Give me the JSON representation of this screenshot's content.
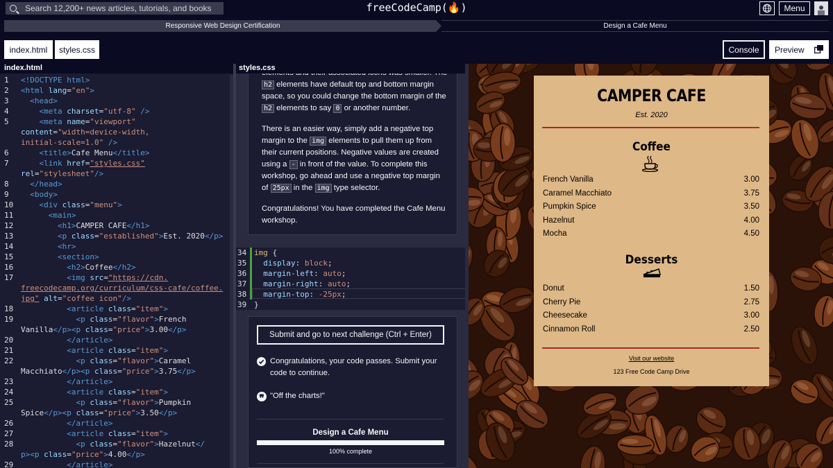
{
  "nav": {
    "search_placeholder": "Search 12,200+ news articles, tutorials, and books",
    "logo": "freeCodeCamp(🔥)",
    "menu_label": "Menu"
  },
  "breadcrumb": {
    "certification": "Responsive Web Design Certification",
    "workshop": "Design a Cafe Menu"
  },
  "tabs": {
    "index": "index.html",
    "styles": "styles.css"
  },
  "buttons": {
    "console": "Console",
    "preview": "Preview"
  },
  "left_editor": {
    "title": "index.html",
    "lines": [
      {
        "n": "1",
        "h": "<span class='t'>&lt;!DOCTYPE html&gt;</span>"
      },
      {
        "n": "2",
        "h": "<span class='t'>&lt;html</span> <span class='a'>lang</span>=<span class='s'>\"en\"</span><span class='t'>&gt;</span>"
      },
      {
        "n": "3",
        "h": "  <span class='t'>&lt;head&gt;</span>"
      },
      {
        "n": "4",
        "h": "    <span class='t'>&lt;meta</span> <span class='a'>charset</span>=<span class='s'>\"utf-8\"</span> <span class='t'>/&gt;</span>"
      },
      {
        "n": "5",
        "h": "    <span class='t'>&lt;meta</span> <span class='a'>name</span>=<span class='s'>\"viewport\"</span>"
      },
      {
        "n": "",
        "h": "<span class='a'>content</span>=<span class='s'>\"width=device-width,</span>"
      },
      {
        "n": "",
        "h": "<span class='s'>initial-scale=1.0\"</span> <span class='t'>/&gt;</span>"
      },
      {
        "n": "6",
        "h": "    <span class='t'>&lt;title&gt;</span>Cafe Menu<span class='t'>&lt;/title&gt;</span>"
      },
      {
        "n": "7",
        "h": "    <span class='t'>&lt;link</span> <span class='a'>href</span>=<span class='s u'>\"styles.css\"</span>"
      },
      {
        "n": "",
        "h": "<span class='a'>rel</span>=<span class='s'>\"stylesheet\"</span><span class='t'>/&gt;</span>"
      },
      {
        "n": "8",
        "h": "  <span class='t'>&lt;/head&gt;</span>"
      },
      {
        "n": "9",
        "h": "  <span class='t'>&lt;body&gt;</span>"
      },
      {
        "n": "10",
        "h": "    <span class='t'>&lt;div</span> <span class='a'>class</span>=<span class='s'>\"menu\"</span><span class='t'>&gt;</span>"
      },
      {
        "n": "11",
        "h": "      <span class='t'>&lt;main&gt;</span>"
      },
      {
        "n": "12",
        "h": "        <span class='t'>&lt;h1&gt;</span>CAMPER CAFE<span class='t'>&lt;/h1&gt;</span>"
      },
      {
        "n": "13",
        "h": "        <span class='t'>&lt;p</span> <span class='a'>class</span>=<span class='s'>\"established\"</span><span class='t'>&gt;</span>Est. 2020<span class='t'>&lt;/p&gt;</span>"
      },
      {
        "n": "14",
        "h": "        <span class='t'>&lt;hr&gt;</span>"
      },
      {
        "n": "15",
        "h": "        <span class='t'>&lt;section&gt;</span>"
      },
      {
        "n": "16",
        "h": "          <span class='t'>&lt;h2&gt;</span>Coffee<span class='t'>&lt;/h2&gt;</span>"
      },
      {
        "n": "17",
        "h": "          <span class='t'>&lt;img</span> <span class='a'>src</span>=<span class='s u'>\"https://cdn.</span>"
      },
      {
        "n": "",
        "h": "<span class='s u'>freecodecamp.org/curriculum/css-cafe/coffee.</span>"
      },
      {
        "n": "",
        "h": "<span class='s u'>jpg\"</span> <span class='a'>alt</span>=<span class='s'>\"coffee icon\"</span><span class='t'>/&gt;</span>"
      },
      {
        "n": "18",
        "h": "          <span class='t'>&lt;article</span> <span class='a'>class</span>=<span class='s'>\"item\"</span><span class='t'>&gt;</span>"
      },
      {
        "n": "19",
        "h": "            <span class='t'>&lt;p</span> <span class='a'>class</span>=<span class='s'>\"flavor\"</span><span class='t'>&gt;</span>French"
      },
      {
        "n": "",
        "h": "Vanilla<span class='t'>&lt;/p&gt;&lt;p</span> <span class='a'>class</span>=<span class='s'>\"price\"</span><span class='t'>&gt;</span>3.00<span class='t'>&lt;/p&gt;</span>"
      },
      {
        "n": "20",
        "h": "          <span class='t'>&lt;/article&gt;</span>"
      },
      {
        "n": "21",
        "h": "          <span class='t'>&lt;article</span> <span class='a'>class</span>=<span class='s'>\"item\"</span><span class='t'>&gt;</span>"
      },
      {
        "n": "22",
        "h": "            <span class='t'>&lt;p</span> <span class='a'>class</span>=<span class='s'>\"flavor\"</span><span class='t'>&gt;</span>Caramel"
      },
      {
        "n": "",
        "h": "Macchiato<span class='t'>&lt;/p&gt;&lt;p</span> <span class='a'>class</span>=<span class='s'>\"price\"</span><span class='t'>&gt;</span>3.75<span class='t'>&lt;/p&gt;</span>"
      },
      {
        "n": "23",
        "h": "          <span class='t'>&lt;/article&gt;</span>"
      },
      {
        "n": "24",
        "h": "          <span class='t'>&lt;article</span> <span class='a'>class</span>=<span class='s'>\"item\"</span><span class='t'>&gt;</span>"
      },
      {
        "n": "25",
        "h": "            <span class='t'>&lt;p</span> <span class='a'>class</span>=<span class='s'>\"flavor\"</span><span class='t'>&gt;</span>Pumpkin"
      },
      {
        "n": "",
        "h": "Spice<span class='t'>&lt;/p&gt;&lt;p</span> <span class='a'>class</span>=<span class='s'>\"price\"</span><span class='t'>&gt;</span>3.50<span class='t'>&lt;/p&gt;</span>"
      },
      {
        "n": "26",
        "h": "          <span class='t'>&lt;/article&gt;</span>"
      },
      {
        "n": "27",
        "h": "          <span class='t'>&lt;article</span> <span class='a'>class</span>=<span class='s'>\"item\"</span><span class='t'>&gt;</span>"
      },
      {
        "n": "28",
        "h": "            <span class='t'>&lt;p</span> <span class='a'>class</span>=<span class='s'>\"flavor\"</span><span class='t'>&gt;</span>Hazelnut<span class='t'>&lt;/</span>"
      },
      {
        "n": "",
        "h": "<span class='t'>p&gt;&lt;p</span> <span class='a'>class</span>=<span class='s'>\"price\"</span><span class='t'>&gt;</span>4.00<span class='t'>&lt;/p&gt;</span>"
      },
      {
        "n": "29",
        "h": "          <span class='t'>&lt;/article&gt;</span>"
      }
    ]
  },
  "mid_editor": {
    "title": "styles.css",
    "desc_html": "<p>elements and their associated icons was smaller. The <span class='ic'>h2</span> elements have default top and bottom margin space, so you could change the bottom margin of the <span class='ic'>h2</span> elements to say <span class='ic'>0</span> or another number.</p><p>There is an easier way, simply add a negative top margin to the <span class='ic'>img</span> elements to pull them up from their current positions. Negative values are created using a <span class='ic'>-</span> in front of the value. To complete this workshop, go ahead and use a negative top margin of <span class='ic'>25px</span> in the <span class='ic'>img</span> type selector.</p><p>Congratulations! You have completed the Cafe Menu workshop.</p>",
    "lines": [
      {
        "n": "34",
        "h": "<span class='sel'>img</span> {"
      },
      {
        "n": "35",
        "h": "  <span class='prop'>display</span>: <span class='val'>block</span>;"
      },
      {
        "n": "36",
        "h": "  <span class='prop'>margin-left</span>: <span class='val'>auto</span>;"
      },
      {
        "n": "37",
        "h": "  <span class='prop'>margin-right</span>: <span class='val'>auto</span>;"
      },
      {
        "n": "38",
        "h": "  <span class='prop'>margin-top</span>: <span class='val'>-25px</span>;"
      },
      {
        "n": "39",
        "h": "}"
      }
    ]
  },
  "result": {
    "submit_label": "Submit and go to next challenge (Ctrl + Enter)",
    "pass_msg": "Congratulations, your code passes. Submit your code to continue.",
    "quote": "\"Off the charts!\"",
    "workshop_title": "Design a Cafe Menu",
    "progress_fraction": 1.0,
    "progress_text": "100% complete"
  },
  "preview": {
    "title": "CAMPER CAFE",
    "established": "Est. 2020",
    "coffee_heading": "Coffee",
    "coffee": [
      {
        "flavor": "French Vanilla",
        "price": "3.00"
      },
      {
        "flavor": "Caramel Macchiato",
        "price": "3.75"
      },
      {
        "flavor": "Pumpkin Spice",
        "price": "3.50"
      },
      {
        "flavor": "Hazelnut",
        "price": "4.00"
      },
      {
        "flavor": "Mocha",
        "price": "4.50"
      }
    ],
    "desserts_heading": "Desserts",
    "desserts": [
      {
        "dessert": "Donut",
        "price": "1.50"
      },
      {
        "dessert": "Cherry Pie",
        "price": "2.75"
      },
      {
        "dessert": "Cheesecake",
        "price": "3.00"
      },
      {
        "dessert": "Cinnamon Roll",
        "price": "2.50"
      }
    ],
    "website_link": "Visit our website",
    "address": "123 Free Code Camp Drive"
  },
  "colors": {
    "bg": "#0a0a23",
    "panel": "#1b1b32",
    "card": "#deb887",
    "rule": "#a52a2a",
    "pass_green": "#4ba23a"
  }
}
